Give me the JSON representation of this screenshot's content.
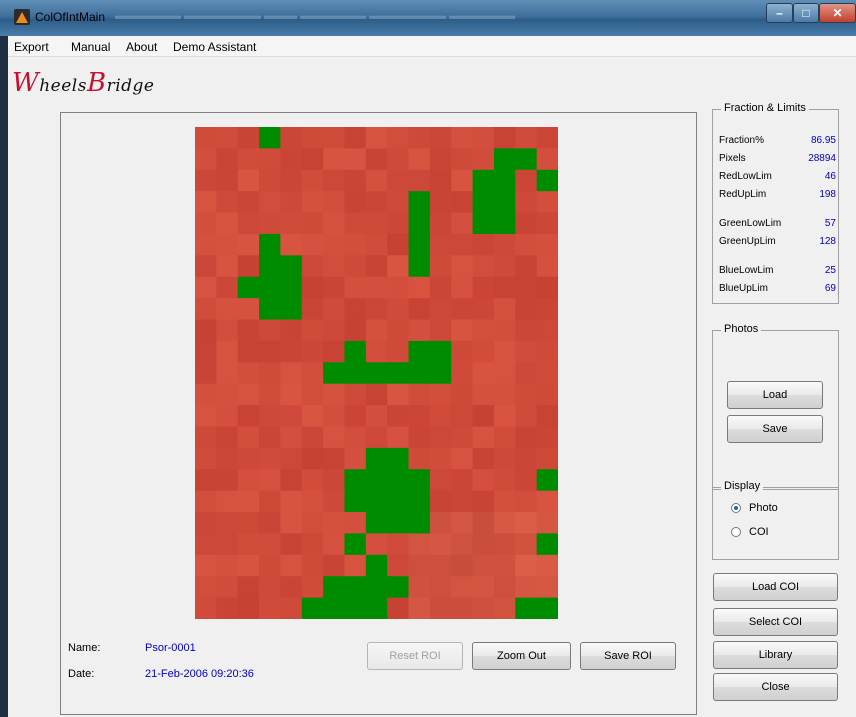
{
  "window": {
    "title": "ColOfIntMain",
    "app_icon": "matlab-icon",
    "controls": {
      "minimize": "–",
      "maximize": "□",
      "close": "✕"
    }
  },
  "menu": [
    "Export",
    "Manual",
    "About",
    "Demo Assistant"
  ],
  "logo": {
    "part1_initial": "W",
    "part1_rest": "heels",
    "part2_initial": "B",
    "part2_rest": "ridge"
  },
  "image_info": {
    "name_label": "Name:",
    "name_value": "Psor-0001",
    "date_label": "Date:",
    "date_value": "21-Feb-2006 09:20:36"
  },
  "roi_buttons": {
    "reset": "Reset ROI",
    "zoom_out": "Zoom Out",
    "save": "Save ROI"
  },
  "fraction_limits": {
    "title": "Fraction & Limits",
    "rows": [
      {
        "label": "Fraction%",
        "value": "86.95"
      },
      {
        "label": "Pixels",
        "value": "28894"
      },
      {
        "label": "RedLowLim",
        "value": "46"
      },
      {
        "label": "RedUpLim",
        "value": "198"
      },
      {
        "label": "GreenLowLim",
        "value": "57"
      },
      {
        "label": "GreenUpLim",
        "value": "128"
      },
      {
        "label": "BlueLowLim",
        "value": "25"
      },
      {
        "label": "BlueUpLim",
        "value": "69"
      }
    ]
  },
  "photos": {
    "title": "Photos",
    "load": "Load",
    "save": "Save"
  },
  "display": {
    "title": "Display",
    "options": [
      "Photo",
      "COI"
    ],
    "selected": "Photo"
  },
  "actions": {
    "load_coi": "Load COI",
    "select_coi": "Select COI",
    "library": "Library",
    "close": "Close"
  },
  "colors": {
    "skin": "#cd4b3c",
    "overlay": "#008c00",
    "value_text": "#0000cc"
  }
}
